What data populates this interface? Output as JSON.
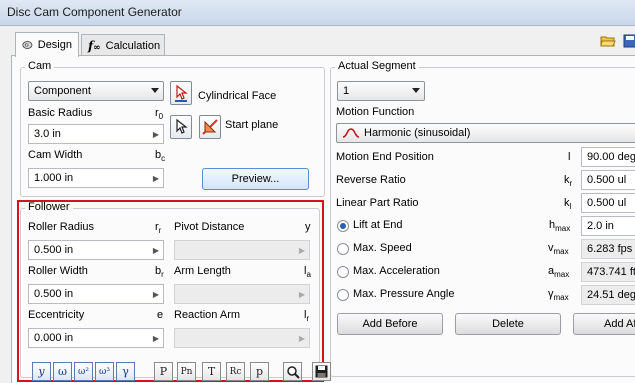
{
  "window": {
    "title": "Disc Cam Component Generator"
  },
  "tabs": [
    {
      "label": "Design",
      "icon": "cam-disc-icon"
    },
    {
      "label": "Calculation",
      "icon": "function-icon"
    }
  ],
  "cam": {
    "group_title": "Cam",
    "type_value": "Component",
    "cylindrical_face_label": "Cylindrical Face",
    "start_plane_label": "Start plane",
    "basic_radius_label": "Basic Radius",
    "basic_radius_symbol": "r",
    "basic_radius_sub": "0",
    "basic_radius_value": "3.0 in",
    "cam_width_label": "Cam Width",
    "cam_width_symbol": "b",
    "cam_width_sub": "c",
    "cam_width_value": "1.000 in",
    "preview_label": "Preview..."
  },
  "follower": {
    "group_title": "Follower",
    "roller_radius_label": "Roller Radius",
    "roller_radius_symbol": "r",
    "roller_radius_sub": "r",
    "roller_radius_value": "0.500 in",
    "pivot_distance_label": "Pivot Distance",
    "pivot_distance_symbol": "y",
    "roller_width_label": "Roller Width",
    "roller_width_symbol": "b",
    "roller_width_sub": "r",
    "roller_width_value": "0.500 in",
    "arm_length_label": "Arm Length",
    "arm_length_symbol": "l",
    "arm_length_sub": "a",
    "eccentricity_label": "Eccentricity",
    "eccentricity_symbol": "e",
    "eccentricity_value": "0.000 in",
    "reaction_arm_label": "Reaction Arm",
    "reaction_arm_symbol": "l",
    "reaction_arm_sub": "r"
  },
  "segment": {
    "group_title": "Actual Segment",
    "segment_value": "1",
    "motion_function_label": "Motion Function",
    "motion_function_value": "Harmonic (sinusoidal)",
    "motion_end_label": "Motion End Position",
    "motion_end_symbol": "l",
    "motion_end_value": "90.00 deg",
    "reverse_ratio_label": "Reverse Ratio",
    "reverse_ratio_symbol": "k",
    "reverse_ratio_sub": "r",
    "reverse_ratio_value": "0.500 ul",
    "linear_part_label": "Linear Part Ratio",
    "linear_part_symbol": "k",
    "linear_part_sub": "l",
    "linear_part_value": "0.500 ul",
    "lift_label": "Lift at End",
    "lift_symbol": "h",
    "lift_sub": "max",
    "lift_value": "2.0 in",
    "max_speed_label": "Max. Speed",
    "max_speed_symbol": "v",
    "max_speed_sub": "max",
    "max_speed_value": "6.283 fps",
    "max_accel_label": "Max. Acceleration",
    "max_accel_symbol": "a",
    "max_accel_sub": "max",
    "max_accel_value": "473.741 ft",
    "max_pressure_label": "Max. Pressure Angle",
    "max_pressure_symbol": "γ",
    "max_pressure_sub": "max",
    "max_pressure_value": "24.51 deg",
    "add_before_label": "Add Before",
    "delete_label": "Delete",
    "add_after_label": "Add Af"
  },
  "bottom_toolbar": [
    {
      "glyph": "y",
      "icon": "displacement-graph-icon"
    },
    {
      "glyph": "ω",
      "icon": "velocity-graph-icon"
    },
    {
      "glyph": "ω²",
      "icon": "acceleration-graph-icon"
    },
    {
      "glyph": "ω³",
      "icon": "jerk-graph-icon"
    },
    {
      "glyph": "γ",
      "icon": "pressure-angle-graph-icon"
    },
    {
      "glyph": "P",
      "icon": "force-graph-icon"
    },
    {
      "glyph": "Pn",
      "icon": "normal-force-graph-icon"
    },
    {
      "glyph": "T",
      "icon": "torque-graph-icon"
    },
    {
      "glyph": "Rc",
      "icon": "curvature-graph-icon"
    },
    {
      "glyph": "p",
      "icon": "pressure-graph-icon"
    },
    {
      "glyph": "",
      "icon": "zoom-icon"
    },
    {
      "glyph": "",
      "icon": "save-icon"
    }
  ],
  "colors": {
    "highlight_border": "#d4141a",
    "accent": "#2a5fb0"
  }
}
